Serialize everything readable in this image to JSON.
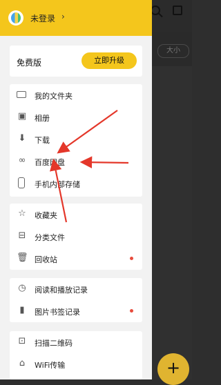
{
  "header": {
    "user_name": "未登录"
  },
  "plan": {
    "label": "免费版",
    "upgrade": "立即升级"
  },
  "group1": [
    {
      "label": "我的文件夹",
      "icon": "folder-icon"
    },
    {
      "label": "相册",
      "icon": "image-icon"
    },
    {
      "label": "下载",
      "icon": "download-icon"
    },
    {
      "label": "百度网盘",
      "icon": "cloud-icon"
    },
    {
      "label": "手机内部存储",
      "icon": "phone-icon"
    }
  ],
  "group2": [
    {
      "label": "收藏夹",
      "icon": "star-icon"
    },
    {
      "label": "分类文件",
      "icon": "box-icon"
    },
    {
      "label": "回收站",
      "icon": "trash-icon",
      "badge": true
    }
  ],
  "group3": [
    {
      "label": "阅读和播放记录",
      "icon": "clock-icon"
    },
    {
      "label": "图片书签记录",
      "icon": "bookmark-icon",
      "badge": true
    }
  ],
  "group4": [
    {
      "label": "扫描二维码",
      "icon": "scan-icon"
    },
    {
      "label": "WiFi传输",
      "icon": "wifi-transfer-icon"
    }
  ],
  "background": {
    "sort_label": "大小",
    "fab": "+"
  },
  "colors": {
    "accent": "#f4c61c",
    "badge": "#e84b3c"
  }
}
